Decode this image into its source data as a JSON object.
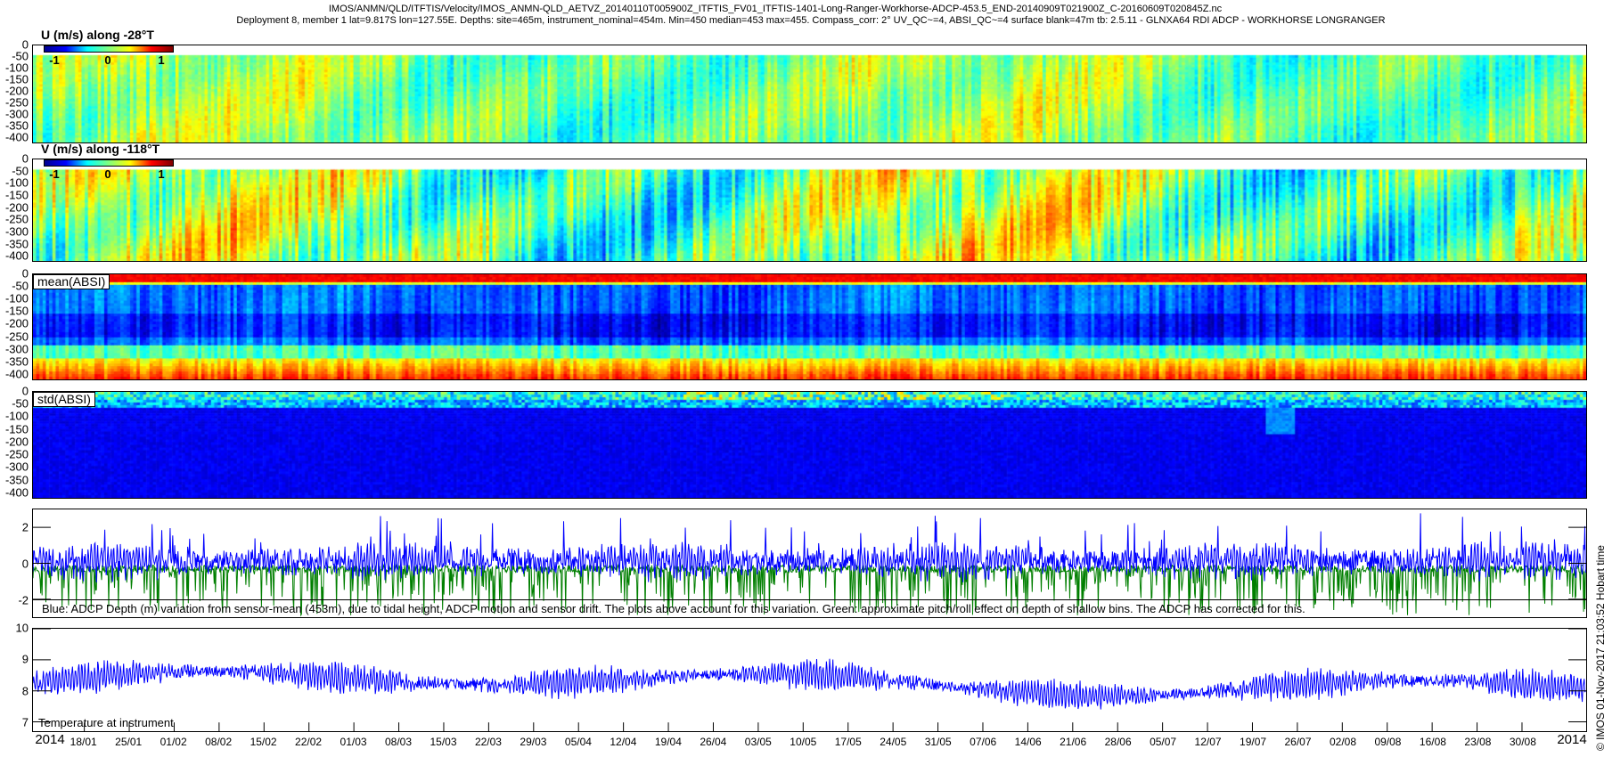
{
  "header": {
    "title_line1": "IMOS/ANMN/QLD/ITFTIS/Velocity/IMOS_ANMN-QLD_AETVZ_20140110T005900Z_ITFTIS_FV01_ITFTIS-1401-Long-Ranger-Workhorse-ADCP-453.5_END-20140909T021900Z_C-20160609T020845Z.nc",
    "title_line2": "Deployment 8, member 1 lat=9.817S lon=127.55E. Depths: site=465m, instrument_nominal=454m. Min=450 median=453 max=455. Compass_corr: 2° UV_QC~=4, ABSI_QC~=4 surface blank=47m tb: 2.5.11 - GLNXA64 RDI ADCP - WORKHORSE LONGRANGER"
  },
  "footer": "© IMOS 01-Nov-2017 21:03:52 Hobart time",
  "chart_data": [
    {
      "type": "heatmap",
      "title": "U (m/s) along -28°T",
      "ylim": [
        -425,
        0
      ],
      "yticks": [
        "0",
        "-50",
        "-100",
        "-150",
        "-200",
        "-250",
        "-300",
        "-350",
        "-400"
      ],
      "colorbar": {
        "range": [
          -1.2,
          1.2
        ],
        "ticks": [
          "-1",
          "0",
          "1"
        ]
      },
      "blank_above": -40,
      "typical_value": 0.0
    },
    {
      "type": "heatmap",
      "title": "V (m/s) along -118°T",
      "ylim": [
        -425,
        0
      ],
      "yticks": [
        "0",
        "-50",
        "-100",
        "-150",
        "-200",
        "-250",
        "-300",
        "-350",
        "-400"
      ],
      "colorbar": {
        "range": [
          -1.2,
          1.2
        ],
        "ticks": [
          "-1",
          "0",
          "1"
        ]
      },
      "blank_above": -40,
      "typical_value": 0.1
    },
    {
      "type": "heatmap",
      "title": "mean(ABSI)",
      "ylim": [
        -425,
        0
      ],
      "yticks": [
        "0",
        "-50",
        "-100",
        "-150",
        "-200",
        "-250",
        "-300",
        "-350",
        "-400"
      ]
    },
    {
      "type": "heatmap",
      "title": "std(ABSI)",
      "ylim": [
        -425,
        0
      ],
      "yticks": [
        "0",
        "-50",
        "-100",
        "-150",
        "-200",
        "-250",
        "-300",
        "-350",
        "-400"
      ]
    },
    {
      "type": "line",
      "ylim": [
        -3,
        3
      ],
      "yticks": [
        "2",
        "0",
        "-2"
      ],
      "series": [
        {
          "name": "ADCP depth variation",
          "color": "#0000ff"
        },
        {
          "name": "pitch/roll effect depth",
          "color": "#007f00"
        }
      ],
      "caption": "Blue: ADCP Depth (m) variation from sensor-mean (453m), due to tidal height, ADCP motion and sensor drift. The plots above account for this variation. Green: approximate pitch/roll effect on depth of shallow bins. The ADCP has corrected for this."
    },
    {
      "type": "line",
      "ylim": [
        6.7,
        10
      ],
      "yticks": [
        "10",
        "9",
        "8",
        "7"
      ],
      "series": [
        {
          "name": "Temperature at instrument",
          "color": "#0000ff",
          "mean": 8.3
        }
      ],
      "label": "Temperature at instrument"
    }
  ],
  "xaxis": {
    "start_date": "2014-01-10",
    "days": 242,
    "year_left": "2014",
    "year_right": "2014",
    "ticks": [
      "18/01",
      "25/01",
      "01/02",
      "08/02",
      "15/02",
      "22/02",
      "01/03",
      "08/03",
      "15/03",
      "22/03",
      "29/03",
      "05/04",
      "12/04",
      "19/04",
      "26/04",
      "03/05",
      "10/05",
      "17/05",
      "24/05",
      "31/05",
      "07/06",
      "14/06",
      "21/06",
      "28/06",
      "05/07",
      "12/07",
      "19/07",
      "26/07",
      "02/08",
      "09/08",
      "16/08",
      "23/08",
      "30/08"
    ],
    "first_tick_day": 8,
    "tick_step_days": 7
  }
}
